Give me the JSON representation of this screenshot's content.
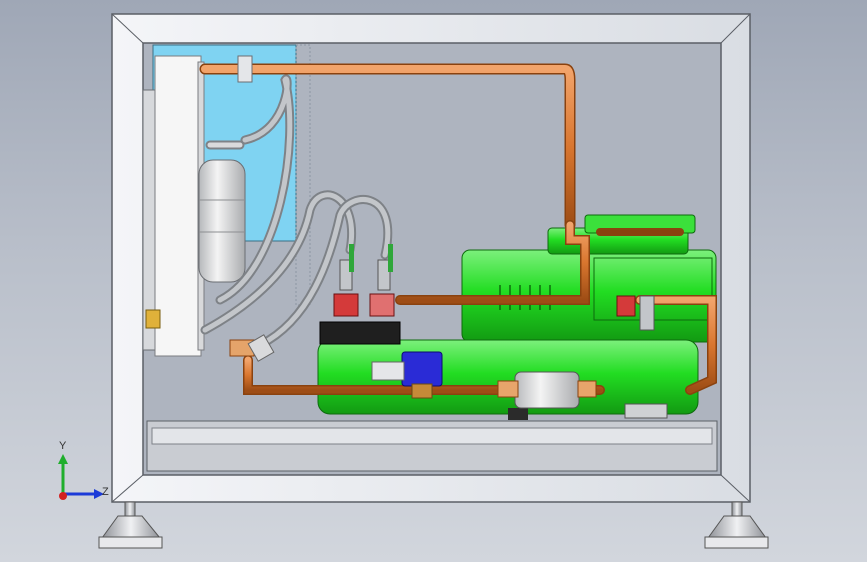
{
  "viewport": {
    "background_top": "#9fa7b6",
    "background_bottom": "#d2d6dd"
  },
  "model": {
    "frame_color": "#e9ecf1",
    "frame_edge_color": "#5b5f66",
    "compressor_color": "#22dd22",
    "receiver_color": "#22dd22",
    "copper_color": "#d9762f",
    "water_tank_color": "#7fd3f2",
    "hose_color": "#9a9ea4",
    "valve_handle_color": "#2fa73a",
    "solenoid_color": "#2a2bd6",
    "sight_glass_color": "#d43a3a"
  },
  "triad": {
    "y_label": "Y",
    "z_label": "Z",
    "y_axis_color": "#1fae2c",
    "z_axis_color": "#1b3ad8",
    "x_axis_color": "#d22020"
  }
}
